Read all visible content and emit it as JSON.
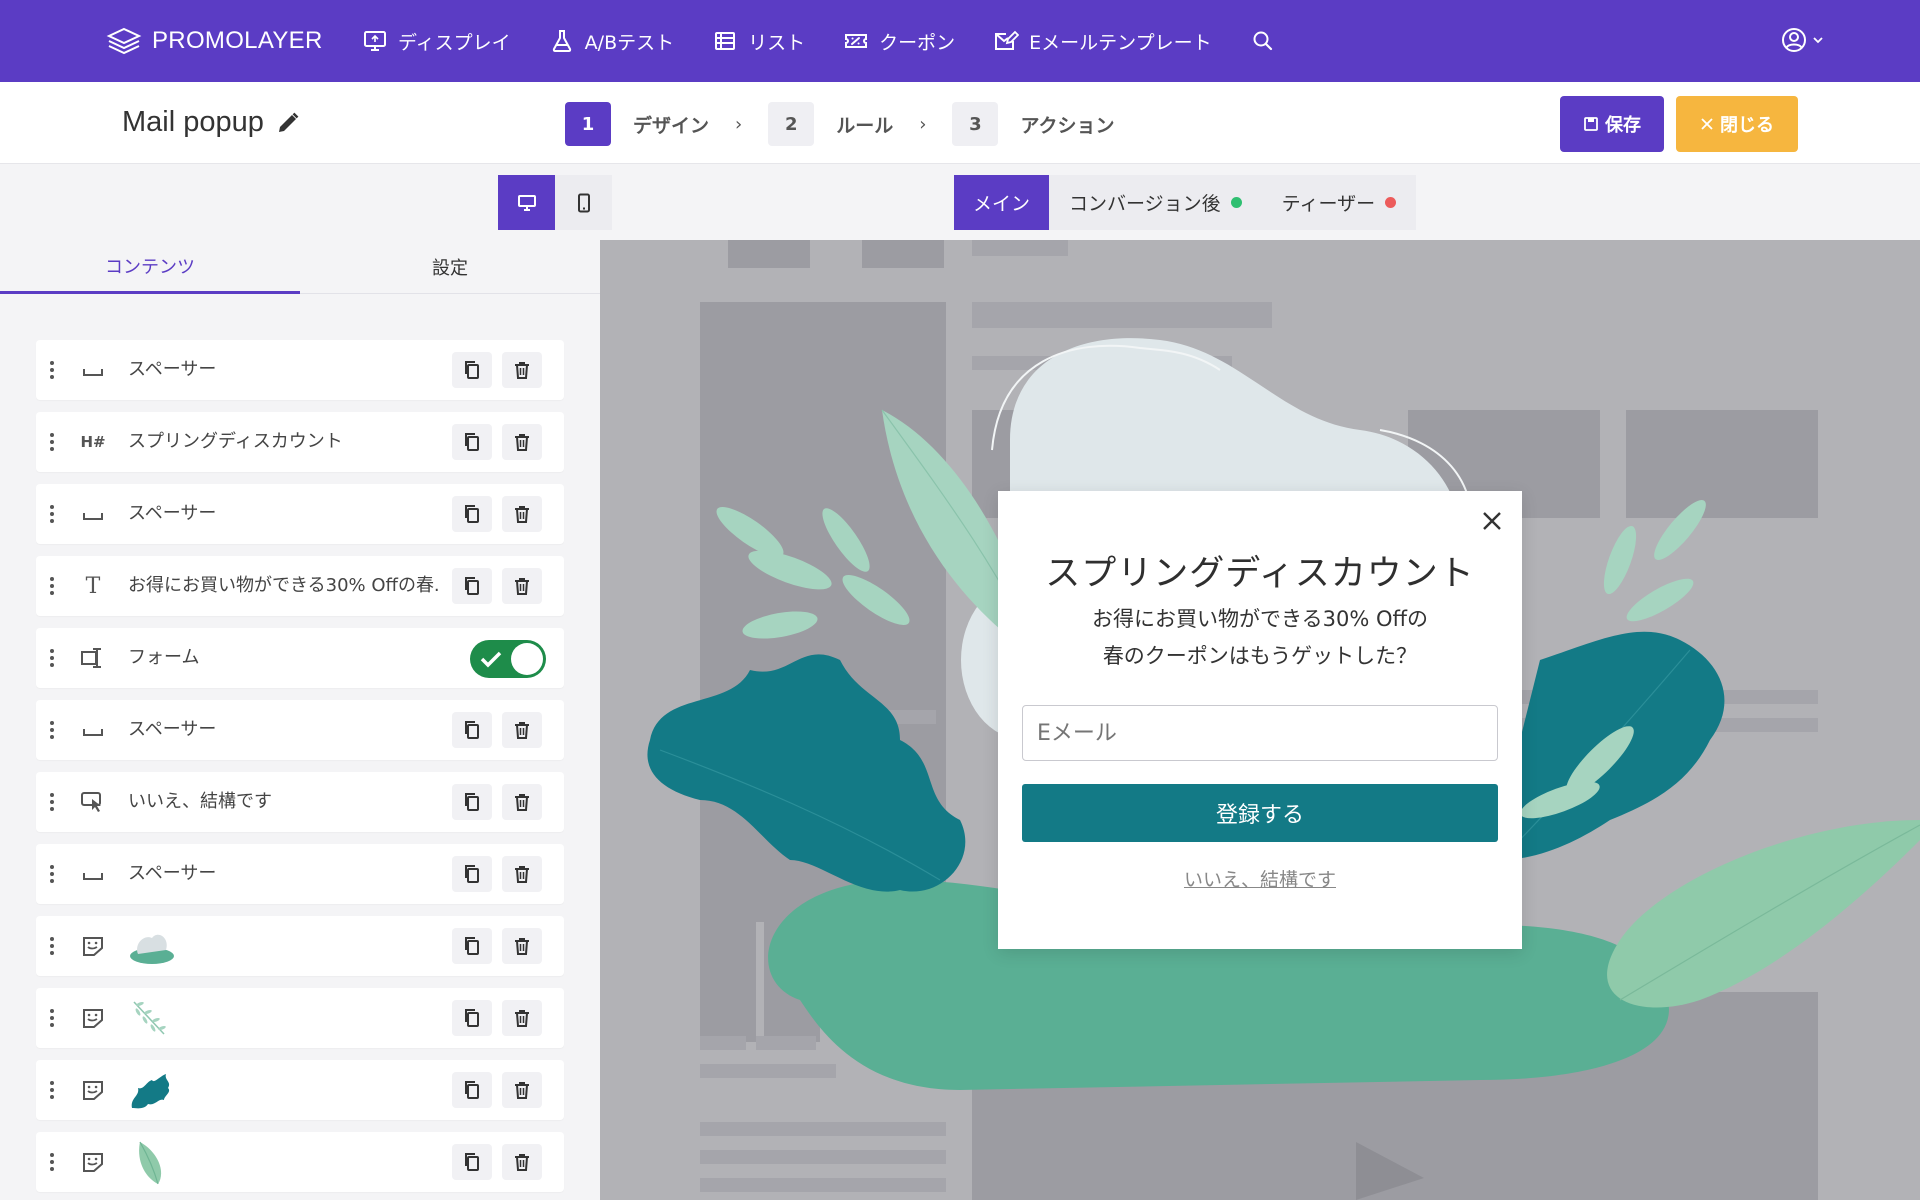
{
  "brand": {
    "name": "PROMOLAYER"
  },
  "nav": {
    "items": [
      {
        "label": "ディスプレイ",
        "icon": "display-icon"
      },
      {
        "label": "A/Bテスト",
        "icon": "flask-icon"
      },
      {
        "label": "リスト",
        "icon": "list-icon"
      },
      {
        "label": "クーポン",
        "icon": "ticket-icon"
      },
      {
        "label": "Eメールテンプレート",
        "icon": "email-template-icon"
      }
    ],
    "search_icon": "search-icon",
    "user_icon": "user-circle-icon"
  },
  "subheader": {
    "title": "Mail popup",
    "steps": [
      {
        "num": "1",
        "label": "デザイン"
      },
      {
        "num": "2",
        "label": "ルール"
      },
      {
        "num": "3",
        "label": "アクション"
      }
    ],
    "save_label": "保存",
    "close_label": "閉じる"
  },
  "view_tabs": {
    "main": "メイン",
    "after": "コンバージョン後",
    "teaser": "ティーザー"
  },
  "panel": {
    "tab_contents": "コンテンツ",
    "tab_settings": "設定",
    "rows": [
      {
        "icon": "spacer-icon",
        "label": "スペーサー",
        "type": "actions"
      },
      {
        "icon": "heading-icon",
        "label": "スプリングディスカウント",
        "type": "actions"
      },
      {
        "icon": "spacer-icon",
        "label": "スペーサー",
        "type": "actions"
      },
      {
        "icon": "text-icon",
        "label": "お得にお買い物ができる30% Offの春.",
        "type": "actions"
      },
      {
        "icon": "form-icon",
        "label": "フォーム",
        "type": "toggle"
      },
      {
        "icon": "spacer-icon",
        "label": "スペーサー",
        "type": "actions"
      },
      {
        "icon": "click-icon",
        "label": "いいえ、結構です",
        "type": "actions"
      },
      {
        "icon": "spacer-icon",
        "label": "スペーサー",
        "type": "actions"
      },
      {
        "icon": "sticker-icon",
        "label": "",
        "thumb": "blob",
        "type": "actions"
      },
      {
        "icon": "sticker-icon",
        "label": "",
        "thumb": "fern",
        "type": "actions"
      },
      {
        "icon": "sticker-icon",
        "label": "",
        "thumb": "teal-leaf",
        "type": "actions"
      },
      {
        "icon": "sticker-icon",
        "label": "",
        "thumb": "green-leaf",
        "type": "actions"
      }
    ]
  },
  "popup": {
    "title": "スプリングディスカウント",
    "body_line1": "お得にお買い物ができる30% Offの",
    "body_line2": "春のクーポンはもうゲットした？",
    "email_placeholder": "Eメール",
    "submit_label": "登録する",
    "decline_label": "いいえ、結構です"
  },
  "colors": {
    "brand": "#5b3cc4",
    "accent_orange": "#f6b63f",
    "popup_button": "#137a86",
    "status_green": "#2fbf71",
    "status_red": "#ec5b5b",
    "toggle_on": "#1e8c4a"
  }
}
